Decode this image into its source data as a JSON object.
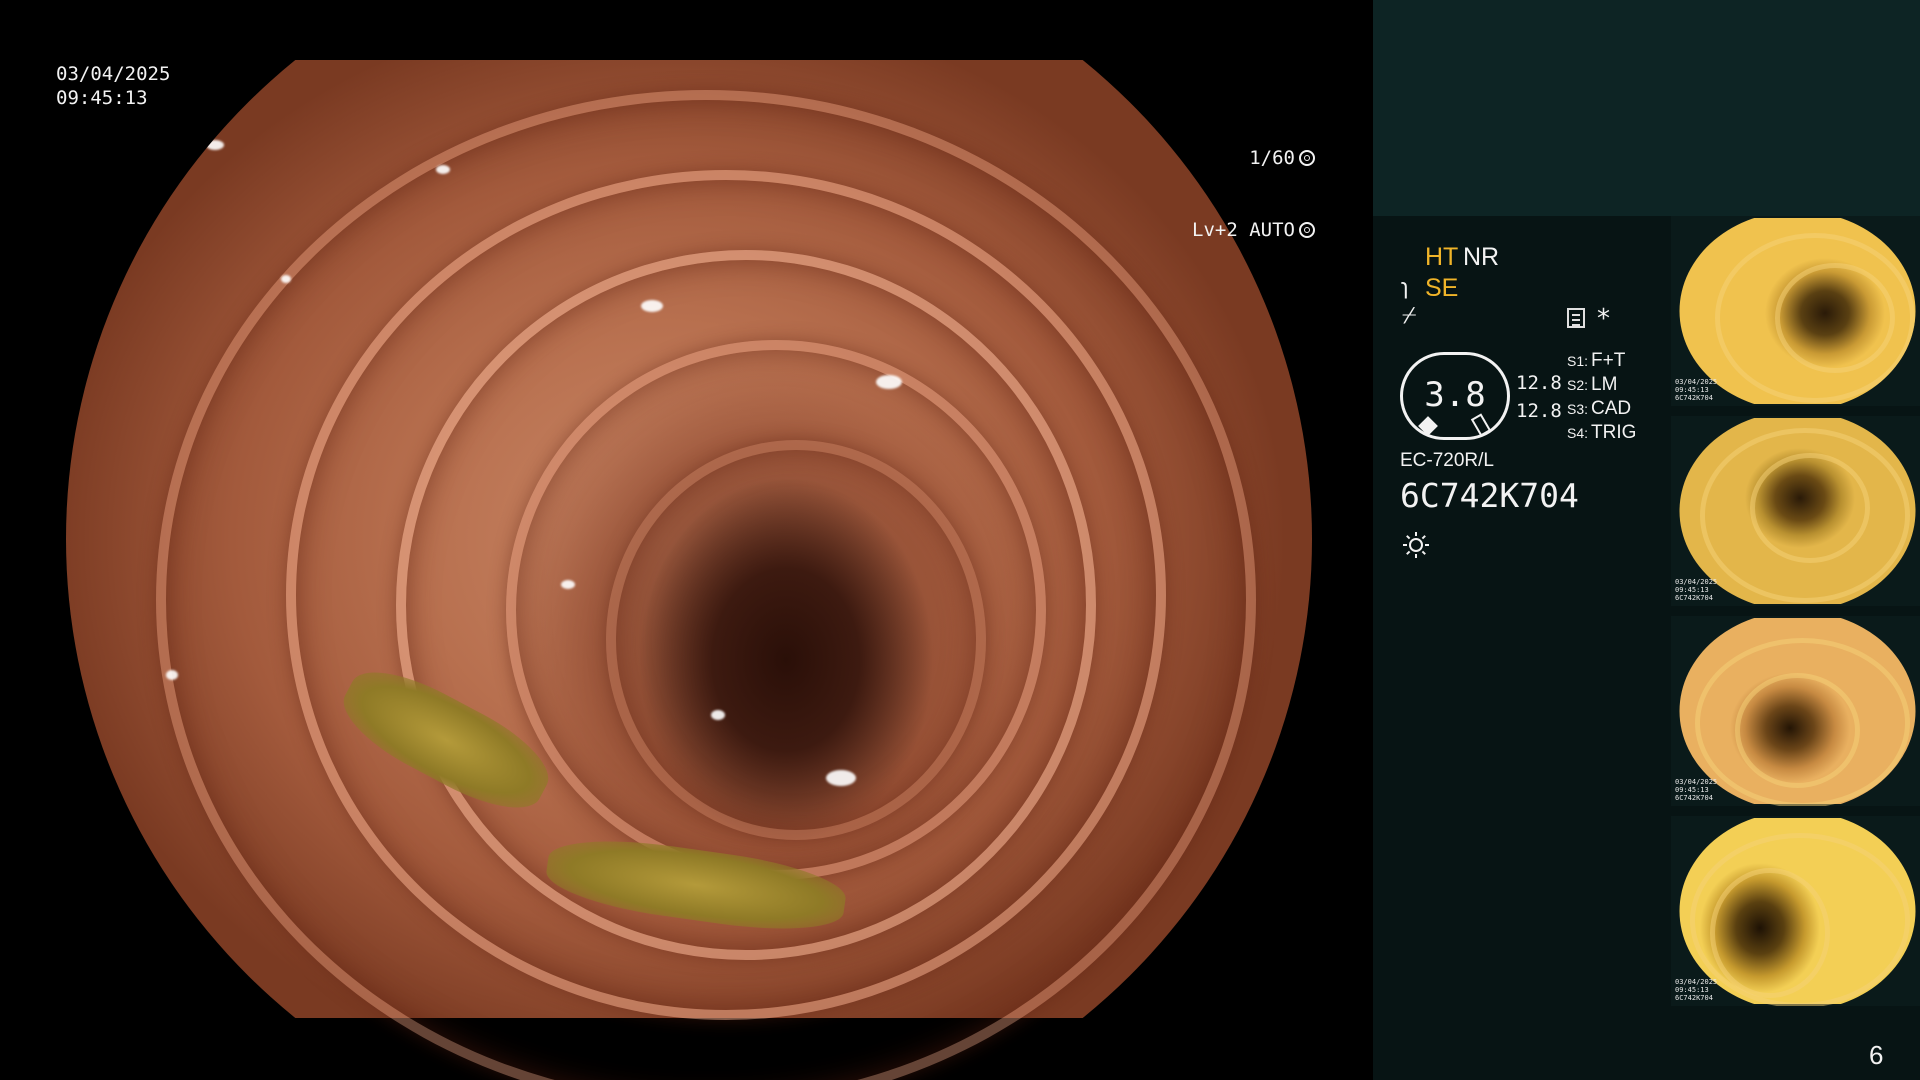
{
  "overlay": {
    "date": "03/04/2025",
    "time": "09:45:13",
    "shutter": "1/60",
    "shutter_icon": "aperture-icon",
    "exposure_mode": "Lv+2 AUTO",
    "exposure_icon": "target-icon"
  },
  "panel": {
    "mode_ht": "HT",
    "mode_nr": "NR",
    "mode_se": "SE",
    "mode_se_symbol": "ɿ",
    "slash_symbol": "⌿",
    "memo_icon": "memo-icon",
    "asterisk": "*",
    "gauge_value": "3.8",
    "value_a": "12.8",
    "value_b": "12.8",
    "presets": [
      {
        "key": "S1:",
        "label": "F+T"
      },
      {
        "key": "S2:",
        "label": "LM"
      },
      {
        "key": "S3:",
        "label": "CAD"
      },
      {
        "key": "S4:",
        "label": "TRIG"
      }
    ],
    "scope_model": "EC-720R/L",
    "scope_serial": "6C742K704",
    "light_icon": "light-source-icon",
    "highlight_color": "#f0b429"
  },
  "thumbnails": [
    {
      "caption": "03/04/2025\n09:45:13\n6C742K704"
    },
    {
      "caption": "03/04/2025\n09:45:13\n6C742K704"
    },
    {
      "caption": "03/04/2025\n09:45:13\n6C742K704"
    },
    {
      "caption": "03/04/2025\n09:45:13\n6C742K704"
    }
  ],
  "page_number": "6"
}
